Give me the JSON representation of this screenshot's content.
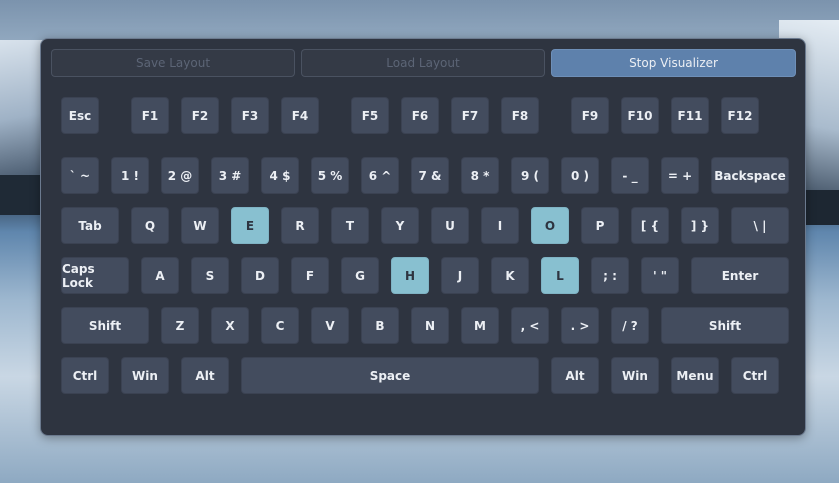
{
  "toolbar": {
    "save_label": "Save Layout",
    "load_label": "Load Layout",
    "stop_label": "Stop Visualizer"
  },
  "colors": {
    "panel": "#2e3440",
    "key": "#434c5e",
    "key_text": "#eceff4",
    "highlight": "#88c0d0",
    "accent_button": "#5e81ac"
  },
  "highlighted_keys": [
    "E",
    "O",
    "H",
    "L"
  ],
  "keys": {
    "esc": "Esc",
    "f1": "F1",
    "f2": "F2",
    "f3": "F3",
    "f4": "F4",
    "f5": "F5",
    "f6": "F6",
    "f7": "F7",
    "f8": "F8",
    "f9": "F9",
    "f10": "F10",
    "f11": "F11",
    "f12": "F12",
    "grave": "` ~",
    "n1": "1 !",
    "n2": "2 @",
    "n3": "3 #",
    "n4": "4 $",
    "n5": "5 %",
    "n6": "6 ^",
    "n7": "7 &",
    "n8": "8 *",
    "n9": "9 (",
    "n0": "0 )",
    "minus": "- _",
    "equal": "= +",
    "backspace": "Backspace",
    "tab": "Tab",
    "q": "Q",
    "w": "W",
    "e": "E",
    "r": "R",
    "t": "T",
    "y": "Y",
    "u": "U",
    "i": "I",
    "o": "O",
    "p": "P",
    "lbracket": "[ {",
    "rbracket": "] }",
    "backslash": "\\ |",
    "caps": "Caps Lock",
    "a": "A",
    "s": "S",
    "d": "D",
    "f": "F",
    "g": "G",
    "h": "H",
    "j": "J",
    "k": "K",
    "l": "L",
    "semicolon": "; :",
    "quote": "' \"",
    "enter": "Enter",
    "lshift": "Shift",
    "z": "Z",
    "x": "X",
    "c": "C",
    "v": "V",
    "b": "B",
    "n": "N",
    "m": "M",
    "comma": ", <",
    "period": ". >",
    "slash": "/ ?",
    "rshift": "Shift",
    "lctrl": "Ctrl",
    "lwin": "Win",
    "lalt": "Alt",
    "space": "Space",
    "ralt": "Alt",
    "rwin": "Win",
    "menu": "Menu",
    "rctrl": "Ctrl"
  }
}
